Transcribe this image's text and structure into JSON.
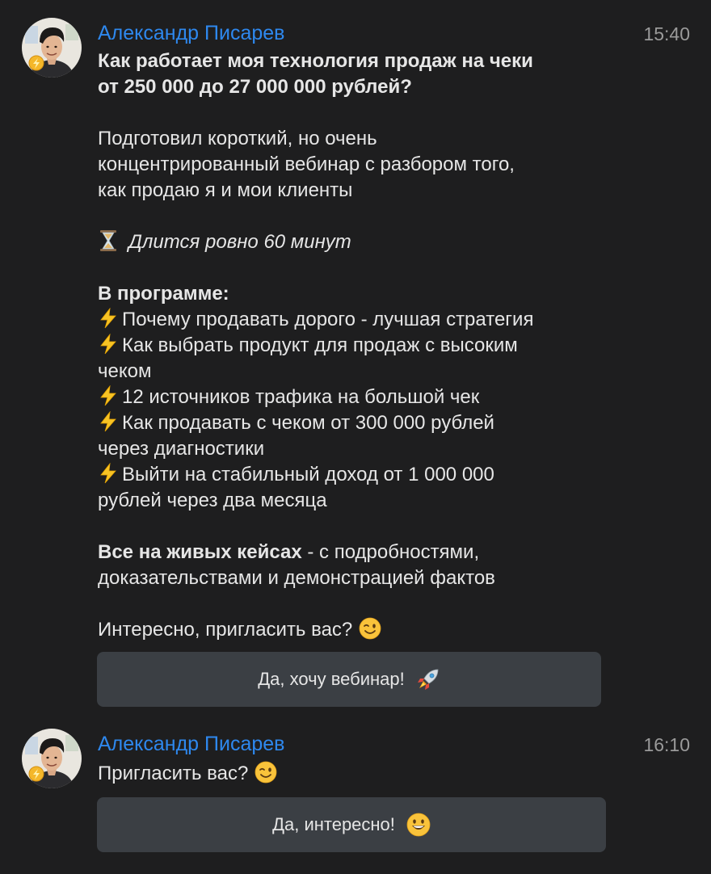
{
  "messages": [
    {
      "author": "Александр Писарев",
      "time": "15:40",
      "title_line1": "Как работает моя технология продаж на чеки",
      "title_line2": "от 250 000 до 27 000 000 рублей?",
      "para1_line1": "Подготовил короткий, но очень",
      "para1_line2": "концентрированный вебинар с разбором того,",
      "para1_line3": "как продаю я и мои клиенты",
      "duration": "Длится ровно 60 минут",
      "program_heading": "В программе:",
      "program_items": [
        {
          "line1": "Почему продавать дорого - лучшая стратегия",
          "line2": ""
        },
        {
          "line1": "Как выбрать продукт для продаж с высоким",
          "line2": "чеком"
        },
        {
          "line1": "12 источников трафика на большой чек",
          "line2": ""
        },
        {
          "line1": "Как продавать с чеком от 300 000 рублей",
          "line2": "через диагностики"
        },
        {
          "line1": "Выйти на стабильный доход от 1 000 000",
          "line2": "рублей через два месяца"
        }
      ],
      "cases_bold": "Все на живых кейсах",
      "cases_rest": " - с подробностями,",
      "cases_line2": "доказательствами и демонстрацией фактов",
      "question": "Интересно, пригласить вас?",
      "button_label": "Да, хочу вебинар!"
    },
    {
      "author": "Александр Писарев",
      "time": "16:10",
      "question": "Пригласить вас?",
      "button_label": "Да, интересно!"
    }
  ],
  "icons": {
    "avatar": "avatar-photo",
    "bolt": "high-voltage-emoji",
    "hourglass": "hourglass-emoji",
    "wink": "winking-face-emoji",
    "rocket": "rocket-emoji",
    "grin": "grinning-face-emoji"
  },
  "colors": {
    "background": "#1e1e1f",
    "author": "#2e88ee",
    "button": "#3b3f44",
    "text": "#e6e6e6",
    "time": "#9a9a9a"
  }
}
